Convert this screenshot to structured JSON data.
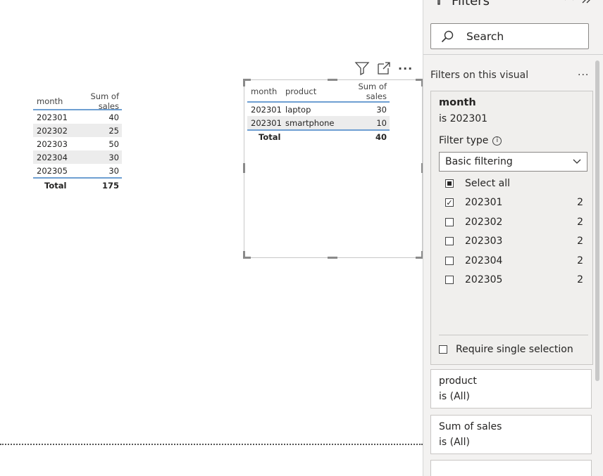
{
  "left_table": {
    "headers": [
      "month",
      "Sum of sales"
    ],
    "rows": [
      {
        "month": "202301",
        "sales": "40"
      },
      {
        "month": "202302",
        "sales": "25"
      },
      {
        "month": "202303",
        "sales": "50"
      },
      {
        "month": "202304",
        "sales": "30"
      },
      {
        "month": "202305",
        "sales": "30"
      }
    ],
    "total_label": "Total",
    "total_value": "175"
  },
  "visual": {
    "more_label": "···",
    "table": {
      "headers": [
        "month",
        "product",
        "Sum of sales"
      ],
      "rows": [
        {
          "month": "202301",
          "product": "laptop",
          "sales": "30"
        },
        {
          "month": "202301",
          "product": "smartphone",
          "sales": "10"
        }
      ],
      "total_label": "Total",
      "total_value": "40"
    }
  },
  "filters_pane": {
    "title": "Filters",
    "search_placeholder": "Search",
    "section_label": "Filters on this visual",
    "section_more": "...",
    "month_card": {
      "field": "month",
      "state": "is 202301",
      "filter_type_label": "Filter type",
      "filter_type_value": "Basic filtering",
      "options": [
        {
          "label": "Select all",
          "count": "",
          "state": "partial"
        },
        {
          "label": "202301",
          "count": "2",
          "state": "checked"
        },
        {
          "label": "202302",
          "count": "2",
          "state": "unchecked"
        },
        {
          "label": "202303",
          "count": "2",
          "state": "unchecked"
        },
        {
          "label": "202304",
          "count": "2",
          "state": "unchecked"
        },
        {
          "label": "202305",
          "count": "2",
          "state": "unchecked"
        }
      ],
      "require_single_label": "Require single selection"
    },
    "product_card": {
      "field": "product",
      "state": "is (All)"
    },
    "sales_card": {
      "field": "Sum of sales",
      "state": "is (All)"
    }
  },
  "colors": {
    "accent": "#6e9fd2",
    "pane_bg": "#f3f2f1",
    "alt_row": "#ececec"
  }
}
